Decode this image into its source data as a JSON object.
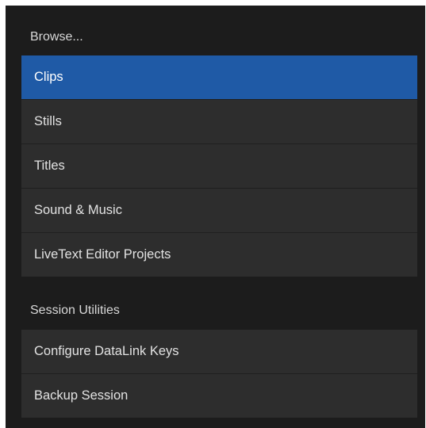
{
  "browse": {
    "header": "Browse...",
    "items": [
      {
        "label": "Clips",
        "selected": true
      },
      {
        "label": "Stills",
        "selected": false
      },
      {
        "label": "Titles",
        "selected": false
      },
      {
        "label": "Sound & Music",
        "selected": false
      },
      {
        "label": "LiveText Editor Projects",
        "selected": false
      }
    ]
  },
  "session_utilities": {
    "header": "Session Utilities",
    "items": [
      {
        "label": "Configure DataLink Keys"
      },
      {
        "label": "Backup Session"
      }
    ]
  },
  "colors": {
    "panel_background": "#1c1c1c",
    "item_background": "#2d2d2d",
    "selected_background": "#1f5aa6",
    "text": "#e2e2e2"
  }
}
